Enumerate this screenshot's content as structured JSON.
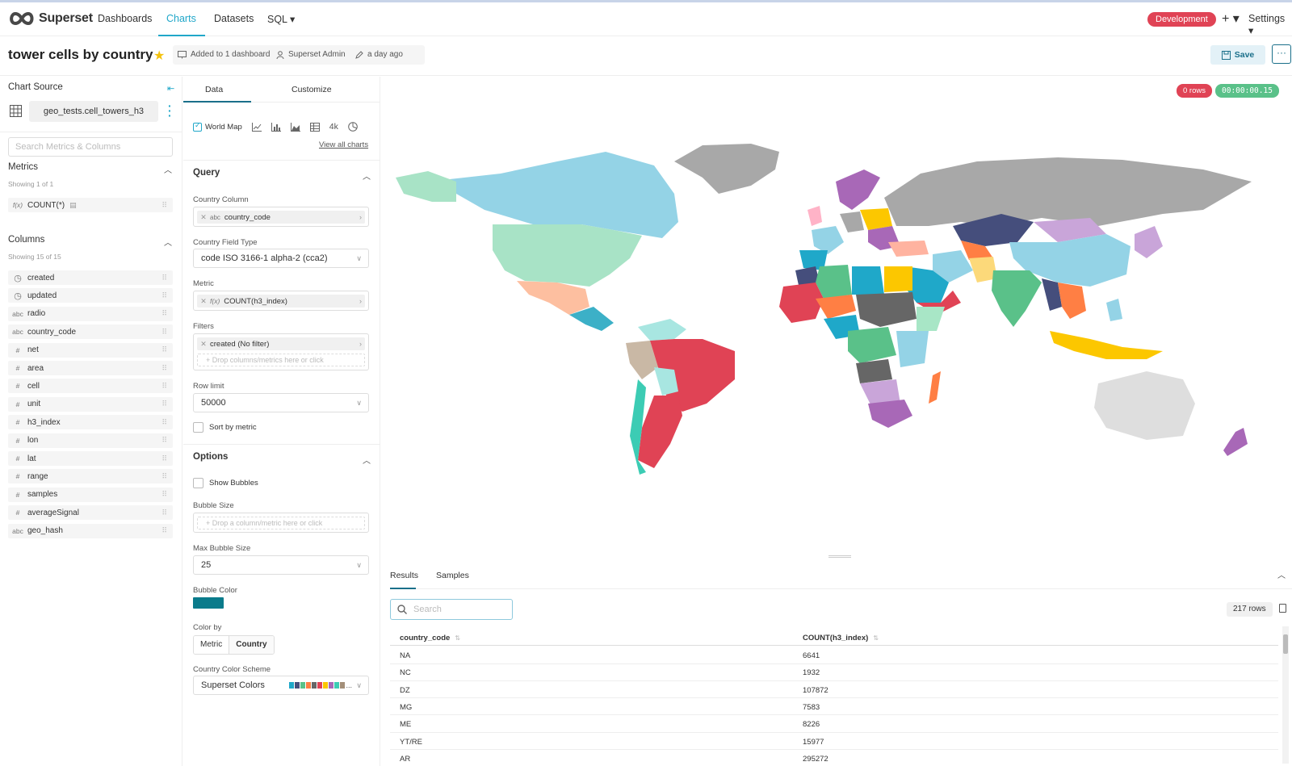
{
  "nav": {
    "brand": "Superset",
    "items": [
      "Dashboards",
      "Charts",
      "Datasets",
      "SQL ▾"
    ],
    "env": "Development",
    "plus": "+ ▾",
    "settings": "Settings ▾"
  },
  "title_row": {
    "title": "tower cells by country",
    "dashboards": "Added to 1 dashboard",
    "owner": "Superset Admin",
    "modified": "a day ago",
    "save": "Save",
    "more": "···"
  },
  "left": {
    "source_title": "Chart Source",
    "dataset": "geo_tests.cell_towers_h3",
    "search_placeholder": "Search Metrics & Columns",
    "metrics_title": "Metrics",
    "metrics_count": "Showing 1 of 1",
    "metrics": [
      {
        "type": "f(x)",
        "name": "COUNT(*)"
      }
    ],
    "columns_title": "Columns",
    "columns_count": "Showing 15 of 15",
    "columns": [
      {
        "type": "clock",
        "name": "created"
      },
      {
        "type": "clock",
        "name": "updated"
      },
      {
        "type": "abc",
        "name": "radio"
      },
      {
        "type": "abc",
        "name": "country_code"
      },
      {
        "type": "#",
        "name": "net"
      },
      {
        "type": "#",
        "name": "area"
      },
      {
        "type": "#",
        "name": "cell"
      },
      {
        "type": "#",
        "name": "unit"
      },
      {
        "type": "#",
        "name": "h3_index"
      },
      {
        "type": "#",
        "name": "lon"
      },
      {
        "type": "#",
        "name": "lat"
      },
      {
        "type": "#",
        "name": "range"
      },
      {
        "type": "#",
        "name": "samples"
      },
      {
        "type": "#",
        "name": "averageSignal"
      },
      {
        "type": "abc",
        "name": "geo_hash"
      }
    ]
  },
  "mid": {
    "tab_data": "Data",
    "tab_customize": "Customize",
    "viz_selected": "World Map",
    "viz_4k": "4k",
    "view_all": "View all charts",
    "query_title": "Query",
    "country_column_label": "Country Column",
    "country_column_type": "abc",
    "country_column_value": "country_code",
    "field_type_label": "Country Field Type",
    "field_type_value": "code ISO 3166-1 alpha-2 (cca2)",
    "metric_label": "Metric",
    "metric_type": "f(x)",
    "metric_value": "COUNT(h3_index)",
    "filters_label": "Filters",
    "filter_value": "created (No filter)",
    "filter_drop": "+ Drop columns/metrics here or click",
    "row_limit_label": "Row limit",
    "row_limit_value": "50000",
    "sort_by_metric": "Sort by metric",
    "options_title": "Options",
    "show_bubbles": "Show Bubbles",
    "bubble_size_label": "Bubble Size",
    "bubble_size_drop": "+ Drop a column/metric here or click",
    "max_bubble_label": "Max Bubble Size",
    "max_bubble_value": "25",
    "bubble_color_label": "Bubble Color",
    "bubble_color": "#0a7b8b",
    "color_by_label": "Color by",
    "color_by_metric": "Metric",
    "color_by_country": "Country",
    "scheme_label": "Country Color Scheme",
    "scheme_value": "Superset Colors",
    "scheme_colors": [
      "#1fa8c9",
      "#454e7c",
      "#5ac189",
      "#ff7f44",
      "#666666",
      "#e04355",
      "#fcc700",
      "#a868b7",
      "#3cccb4",
      "#a38f79"
    ]
  },
  "chart": {
    "rows_badge": "0 rows",
    "time_badge": "00:00:00.15",
    "ocean": "#ffffff",
    "land_default": "#bdbdbd"
  },
  "results": {
    "tab_results": "Results",
    "tab_samples": "Samples",
    "search_placeholder": "Search",
    "row_count": "217 rows",
    "columns": [
      "country_code",
      "COUNT(h3_index)"
    ],
    "rows": [
      [
        "NA",
        "6641"
      ],
      [
        "NC",
        "1932"
      ],
      [
        "DZ",
        "107872"
      ],
      [
        "MG",
        "7583"
      ],
      [
        "ME",
        "8226"
      ],
      [
        "YT/RE",
        "15977"
      ],
      [
        "AR",
        "295272"
      ]
    ]
  }
}
